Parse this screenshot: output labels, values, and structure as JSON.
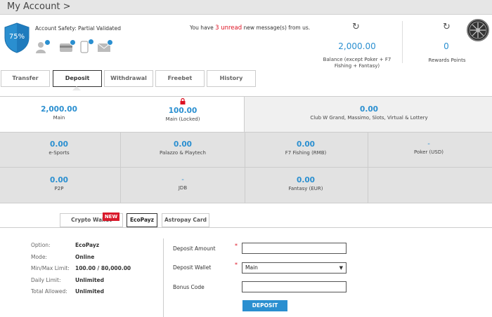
{
  "header": {
    "title": "My Account >"
  },
  "account_safety": {
    "percent": "75%",
    "label": "Account Safety: Partial Validated",
    "icons": [
      "user-verified-icon",
      "card-verified-icon",
      "phone-verified-icon",
      "email-verified-icon"
    ]
  },
  "messages": {
    "prefix": "You have ",
    "count": "3 unread",
    "suffix": " new message(s) from us."
  },
  "balance": {
    "value": "2,000.00",
    "label": "Balance (except Poker + F7 Fishing + Fantasy)"
  },
  "rewards": {
    "value": "0",
    "label": "Rewards Points"
  },
  "tabs": [
    {
      "label": "Transfer"
    },
    {
      "label": "Deposit"
    },
    {
      "label": "Withdrawal"
    },
    {
      "label": "Freebet"
    },
    {
      "label": "History"
    }
  ],
  "wallets": [
    {
      "value": "2,000.00",
      "label": "Main"
    },
    {
      "value": "100.00",
      "label": "Main (Locked)"
    },
    {
      "value": "0.00",
      "label": "Club W Grand, Massimo, Slots, Virtual & Lottery"
    },
    {
      "value": "0.00",
      "label": "e-Sports"
    },
    {
      "value": "0.00",
      "label": "Palazzo & Playtech"
    },
    {
      "value": "0.00",
      "label": "F7 Fishing (RMB)"
    },
    {
      "value": "-",
      "label": "Poker (USD)"
    },
    {
      "value": "0.00",
      "label": "P2P"
    },
    {
      "value": "-",
      "label": "JDB"
    },
    {
      "value": "0.00",
      "label": "Fantasy (EUR)"
    }
  ],
  "payment_tabs": [
    {
      "label": "Crypto Wallet",
      "badge": "NEW"
    },
    {
      "label": "EcoPayz"
    },
    {
      "label": "Astropay Card"
    }
  ],
  "info": [
    {
      "label": "Option:",
      "value": "EcoPayz"
    },
    {
      "label": "Mode:",
      "value": "Online"
    },
    {
      "label": "Min/Max Limit:",
      "value": "100.00 / 80,000.00"
    },
    {
      "label": "Daily Limit:",
      "value": "Unlimited"
    },
    {
      "label": "Total Allowed:",
      "value": "Unlimited"
    }
  ],
  "form": {
    "amount_label": "Deposit Amount",
    "amount_value": "",
    "wallet_label": "Deposit Wallet",
    "wallet_value": "Main",
    "bonus_label": "Bonus Code",
    "bonus_value": "",
    "required_mark": "*",
    "submit_label": "DEPOSIT"
  },
  "colors": {
    "accent": "#2a8fd0",
    "alert": "#d9192a",
    "panel": "#e2e2e2"
  }
}
